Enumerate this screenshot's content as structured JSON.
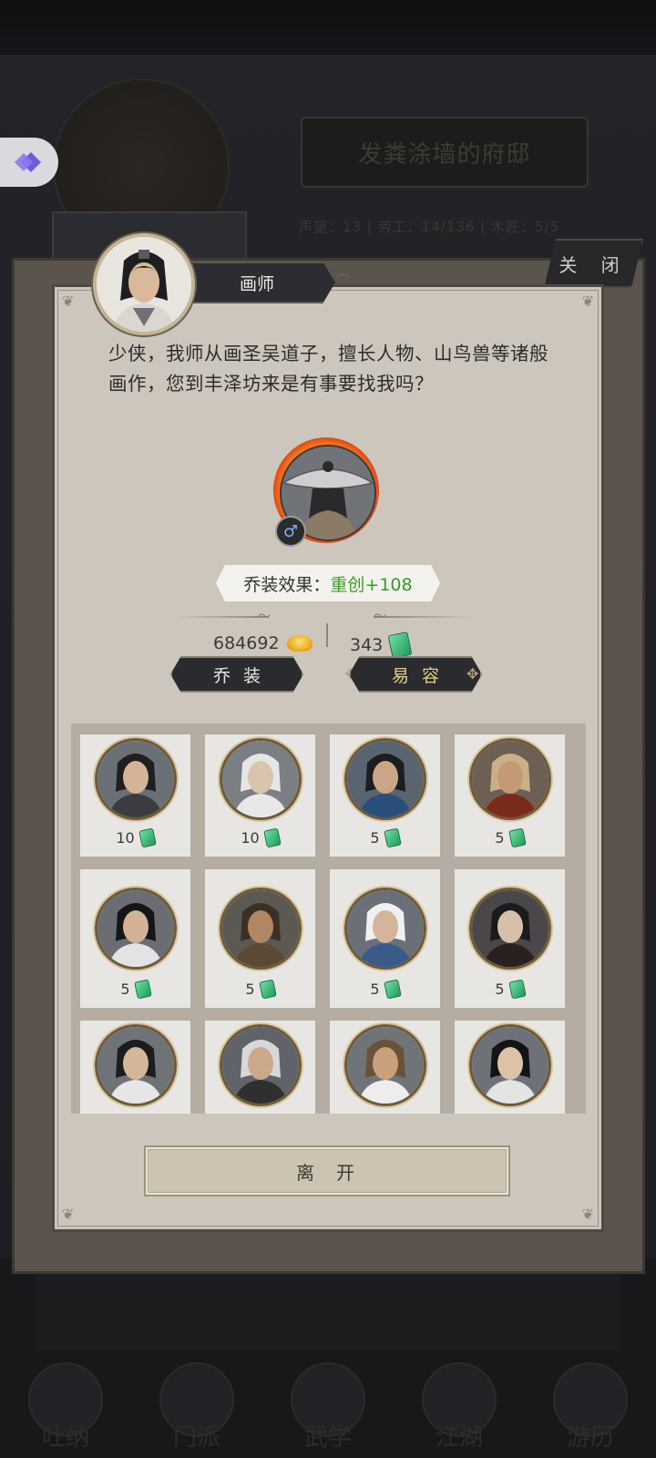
{
  "background": {
    "mansion_title": "发粪涂墙的府邸",
    "stats": "声望：13  |  劳工：14/136  |  木匠：5/5",
    "nav_items": [
      "吐纳",
      "门派",
      "武学",
      "江湖",
      "游历"
    ]
  },
  "close_button": "关 闭",
  "npc": {
    "name": "画师",
    "avatar_icon": "painter-portrait-icon",
    "dialogue": "少侠，我师从画圣吴道子，擅长人物、山鸟兽等诸般画作，您到丰泽坊来是有事要找我吗？"
  },
  "disguise": {
    "portrait_icon": "straw-hat-swordsman-icon",
    "gender_icon": "male-icon",
    "effect_label": "乔装效果：",
    "effect_value": "重创+108"
  },
  "currency": {
    "gold": "684692",
    "gold_icon": "gold-ingot-icon",
    "jade": "343",
    "jade_icon": "jade-token-icon"
  },
  "buttons": {
    "disguise": "乔装",
    "change_face": "易容",
    "leave": "离开"
  },
  "portraits": [
    {
      "cost": "10",
      "icon": "blindfolded-swordsman-icon"
    },
    {
      "cost": "10",
      "icon": "masked-white-hair-icon"
    },
    {
      "cost": "5",
      "icon": "headband-warrior-icon"
    },
    {
      "cost": "5",
      "icon": "scarred-brawler-icon"
    },
    {
      "cost": "5",
      "icon": "long-hair-swordsman-icon"
    },
    {
      "cost": "5",
      "icon": "bearded-general-icon"
    },
    {
      "cost": "5",
      "icon": "white-beard-elder-icon"
    },
    {
      "cost": "5",
      "icon": "painted-face-villain-icon"
    },
    {
      "cost": "",
      "icon": "young-scholar-icon"
    },
    {
      "cost": "",
      "icon": "old-master-icon"
    },
    {
      "cost": "",
      "icon": "fur-collar-noble-icon"
    },
    {
      "cost": "",
      "icon": "topknot-youth-icon"
    }
  ],
  "colors": {
    "effect_green": "#3a9a2a",
    "panel_bg": "#cdc6bd",
    "button_dark": "#2a2b2f"
  }
}
